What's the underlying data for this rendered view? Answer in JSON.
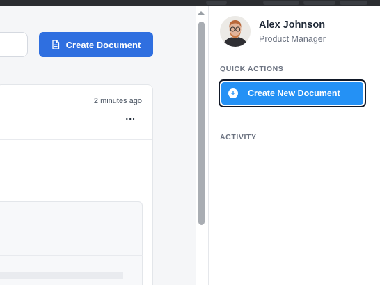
{
  "toolbar": {
    "create_document_label": "Create Document"
  },
  "card": {
    "timestamp": "2 minutes ago",
    "more_label": "..."
  },
  "profile": {
    "name": "Alex Johnson",
    "role": "Product Manager"
  },
  "quick_actions": {
    "heading": "QUICK ACTIONS",
    "create_new_label": "Create New Document"
  },
  "activity": {
    "heading": "ACTIVITY"
  },
  "icons": {
    "document": "document-icon",
    "plus": "plus-circle-icon",
    "more": "more-horizontal-icon"
  },
  "colors": {
    "primary_button": "#2f6fe0",
    "quick_action_button": "#2491f5",
    "focus_ring": "#111827"
  }
}
